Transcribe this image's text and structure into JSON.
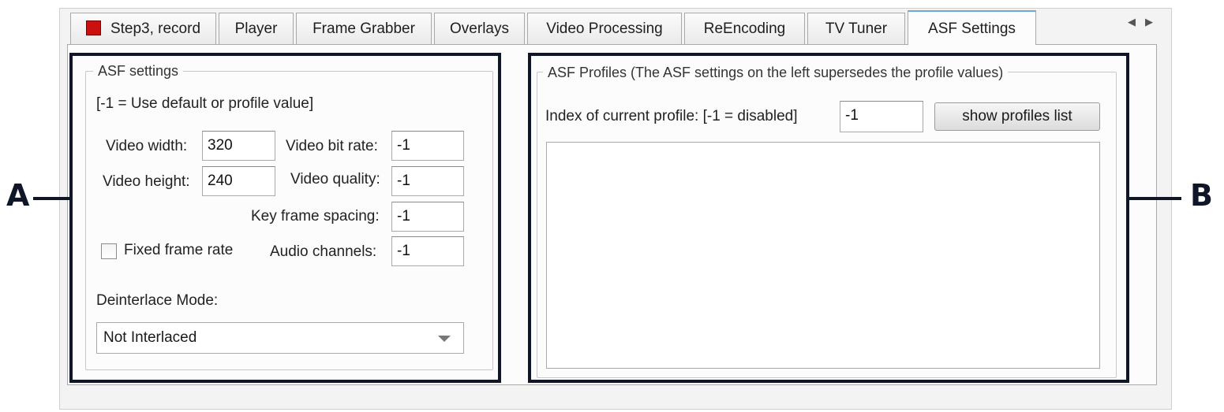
{
  "tabs": [
    {
      "label": "Step3, record",
      "has_record_icon": true
    },
    {
      "label": "Player"
    },
    {
      "label": "Frame Grabber"
    },
    {
      "label": "Overlays"
    },
    {
      "label": "Video Processing"
    },
    {
      "label": "ReEncoding"
    },
    {
      "label": "TV Tuner"
    },
    {
      "label": "ASF Settings",
      "active": true
    }
  ],
  "tab_scroll": {
    "left": "◀",
    "right": "▶"
  },
  "asf_settings": {
    "title": "ASF settings",
    "hint": "[-1 = Use default or profile value]",
    "video_width_label": "Video width:",
    "video_width_value": "320",
    "video_height_label": "Video height:",
    "video_height_value": "240",
    "video_bit_rate_label": "Video bit rate:",
    "video_bit_rate_value": "-1",
    "video_quality_label": "Video quality:",
    "video_quality_value": "-1",
    "key_frame_spacing_label": "Key frame spacing:",
    "key_frame_spacing_value": "-1",
    "fixed_frame_rate_label": "Fixed frame rate",
    "fixed_frame_rate_checked": false,
    "audio_channels_label": "Audio channels:",
    "audio_channels_value": "-1",
    "deinterlace_label": "Deinterlace Mode:",
    "deinterlace_value": "Not Interlaced"
  },
  "asf_profiles": {
    "title": "ASF Profiles (The ASF settings on the left supersedes the profile values)",
    "index_label": "Index of current profile: [-1 = disabled]",
    "index_value": "-1",
    "show_profiles_button": "show profiles list",
    "profiles_list": []
  },
  "callouts": {
    "left": "A",
    "right": "B"
  },
  "colors": {
    "callout": "#0f1628",
    "record_icon": "#cc1010",
    "active_tab_accent": "#6ea8d8"
  }
}
